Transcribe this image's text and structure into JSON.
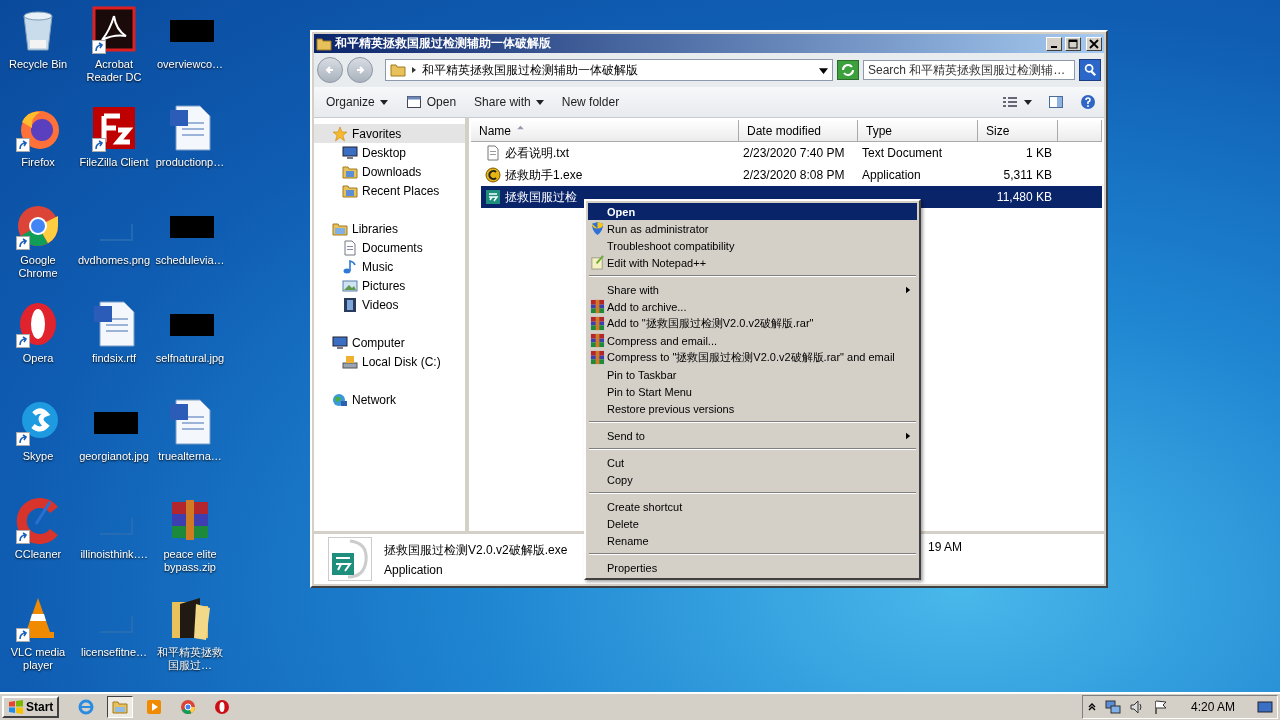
{
  "desktop_icons": [
    {
      "label": "Recycle Bin",
      "kind": "recycle",
      "shortcut": false
    },
    {
      "label": "Firefox",
      "kind": "firefox",
      "shortcut": true
    },
    {
      "label": "Google Chrome",
      "kind": "chrome",
      "shortcut": true
    },
    {
      "label": "Opera",
      "kind": "opera",
      "shortcut": true
    },
    {
      "label": "Skype",
      "kind": "skype",
      "shortcut": true
    },
    {
      "label": "CCleaner",
      "kind": "ccleaner",
      "shortcut": true
    },
    {
      "label": "VLC media player",
      "kind": "vlc",
      "shortcut": true
    },
    {
      "label": "Acrobat Reader DC",
      "kind": "acrobat",
      "shortcut": true
    },
    {
      "label": "FileZilla Client",
      "kind": "filezilla",
      "shortcut": true
    },
    {
      "label": "dvdhomes.png",
      "kind": "blank",
      "shortcut": false
    },
    {
      "label": "findsix.rtf",
      "kind": "word",
      "shortcut": false
    },
    {
      "label": "georgianot.jpg",
      "kind": "black",
      "shortcut": false
    },
    {
      "label": "illinoisthink….",
      "kind": "blank",
      "shortcut": false
    },
    {
      "label": "licensefitne…",
      "kind": "blank",
      "shortcut": false
    },
    {
      "label": "overviewco…",
      "kind": "black",
      "shortcut": false
    },
    {
      "label": "productionp…",
      "kind": "word",
      "shortcut": false
    },
    {
      "label": "schedulevia…",
      "kind": "black",
      "shortcut": false
    },
    {
      "label": "selfnatural.jpg",
      "kind": "black",
      "shortcut": false
    },
    {
      "label": "truealterna…",
      "kind": "word",
      "shortcut": false
    },
    {
      "label": "peace elite bypass.zip",
      "kind": "winrar",
      "shortcut": false
    },
    {
      "label": "和平精英拯救国服过…",
      "kind": "folder",
      "shortcut": false
    }
  ],
  "explorer": {
    "title": "和平精英拯救国服过检测辅助一体破解版",
    "address": "和平精英拯救国服过检测辅助一体破解版",
    "search_placeholder": "Search 和平精英拯救国服过检测辅…",
    "toolbar": [
      {
        "label": "Organize",
        "kind": "menu"
      },
      {
        "label": "Open",
        "kind": "open"
      },
      {
        "label": "Share with",
        "kind": "menu"
      },
      {
        "label": "New folder",
        "kind": "plain"
      }
    ],
    "nav": [
      {
        "label": "Favorites",
        "kind": "favorites",
        "selected": true,
        "children": [
          {
            "label": "Desktop",
            "kind": "desktop",
            "selected": false
          },
          {
            "label": "Downloads",
            "kind": "downloads",
            "selected": false
          },
          {
            "label": "Recent Places",
            "kind": "recent",
            "selected": false
          }
        ]
      },
      {
        "label": "Libraries",
        "kind": "libraries",
        "selected": false,
        "children": [
          {
            "label": "Documents",
            "kind": "documents",
            "selected": false
          },
          {
            "label": "Music",
            "kind": "music",
            "selected": false
          },
          {
            "label": "Pictures",
            "kind": "pictures",
            "selected": false
          },
          {
            "label": "Videos",
            "kind": "videos",
            "selected": false
          }
        ]
      },
      {
        "label": "Computer",
        "kind": "computer",
        "selected": false,
        "children": [
          {
            "label": "Local Disk (C:)",
            "kind": "disk",
            "selected": false
          }
        ]
      },
      {
        "label": "Network",
        "kind": "network",
        "selected": false
      }
    ],
    "columns": [
      {
        "label": "Name",
        "sorted": true
      },
      {
        "label": "Date modified",
        "sorted": false
      },
      {
        "label": "Type",
        "sorted": false
      },
      {
        "label": "Size",
        "sorted": false
      }
    ],
    "files": [
      {
        "name": "必看说明.txt",
        "date": "2/23/2020 7:40 PM",
        "type": "Text Document",
        "size": "1 KB",
        "kind": "text",
        "selected": false
      },
      {
        "name": "拯救助手1.exe",
        "date": "2/23/2020 8:08 PM",
        "type": "Application",
        "size": "5,311 KB",
        "kind": "coin",
        "selected": false
      },
      {
        "name": "拯救国服过检",
        "size": "11,480 KB",
        "kind": "app",
        "selected": true
      }
    ],
    "details": {
      "name": "拯救国服过检测V2.0.v2破解版.exe",
      "type": "Application",
      "date_partial": "19 AM"
    }
  },
  "context_menu": [
    [
      {
        "label": "Open",
        "bold": true,
        "selected": true,
        "submenu": false
      },
      {
        "label": "Run as administrator",
        "kind": "shield",
        "bold": false,
        "selected": false,
        "submenu": false
      },
      {
        "label": "Troubleshoot compatibility",
        "bold": false,
        "selected": false,
        "submenu": false
      },
      {
        "label": "Edit with Notepad++",
        "kind": "notepad",
        "bold": false,
        "selected": false,
        "submenu": false
      }
    ],
    [
      {
        "label": "Share with",
        "bold": false,
        "selected": false,
        "submenu": true
      },
      {
        "label": "Add to archive...",
        "kind": "archive",
        "bold": false,
        "selected": false,
        "submenu": false
      },
      {
        "label": "Add to \"拯救国服过检测V2.0.v2破解版.rar\"",
        "kind": "archive",
        "bold": false,
        "selected": false,
        "submenu": false
      },
      {
        "label": "Compress and email...",
        "kind": "archive",
        "bold": false,
        "selected": false,
        "submenu": false
      },
      {
        "label": "Compress to \"拯救国服过检测V2.0.v2破解版.rar\" and email",
        "kind": "archive",
        "bold": false,
        "selected": false,
        "submenu": false
      },
      {
        "label": "Pin to Taskbar",
        "bold": false,
        "selected": false,
        "submenu": false
      },
      {
        "label": "Pin to Start Menu",
        "bold": false,
        "selected": false,
        "submenu": false
      },
      {
        "label": "Restore previous versions",
        "bold": false,
        "selected": false,
        "submenu": false
      }
    ],
    [
      {
        "label": "Send to",
        "bold": false,
        "selected": false,
        "submenu": true
      }
    ],
    [
      {
        "label": "Cut",
        "bold": false,
        "selected": false,
        "submenu": false
      },
      {
        "label": "Copy",
        "bold": false,
        "selected": false,
        "submenu": false
      }
    ],
    [
      {
        "label": "Create shortcut",
        "bold": false,
        "selected": false,
        "submenu": false
      },
      {
        "label": "Delete",
        "bold": false,
        "selected": false,
        "submenu": false
      },
      {
        "label": "Rename",
        "bold": false,
        "selected": false,
        "submenu": false
      }
    ],
    [
      {
        "label": "Properties",
        "bold": false,
        "selected": false,
        "submenu": false
      }
    ]
  ],
  "taskbar": {
    "start": "Start",
    "apps": [
      {
        "kind": "ie",
        "selected": false
      },
      {
        "kind": "explorer",
        "selected": true
      },
      {
        "kind": "media",
        "selected": false
      },
      {
        "kind": "chrome",
        "selected": false
      },
      {
        "kind": "opera",
        "selected": false
      }
    ],
    "clock": "4:20 AM"
  }
}
